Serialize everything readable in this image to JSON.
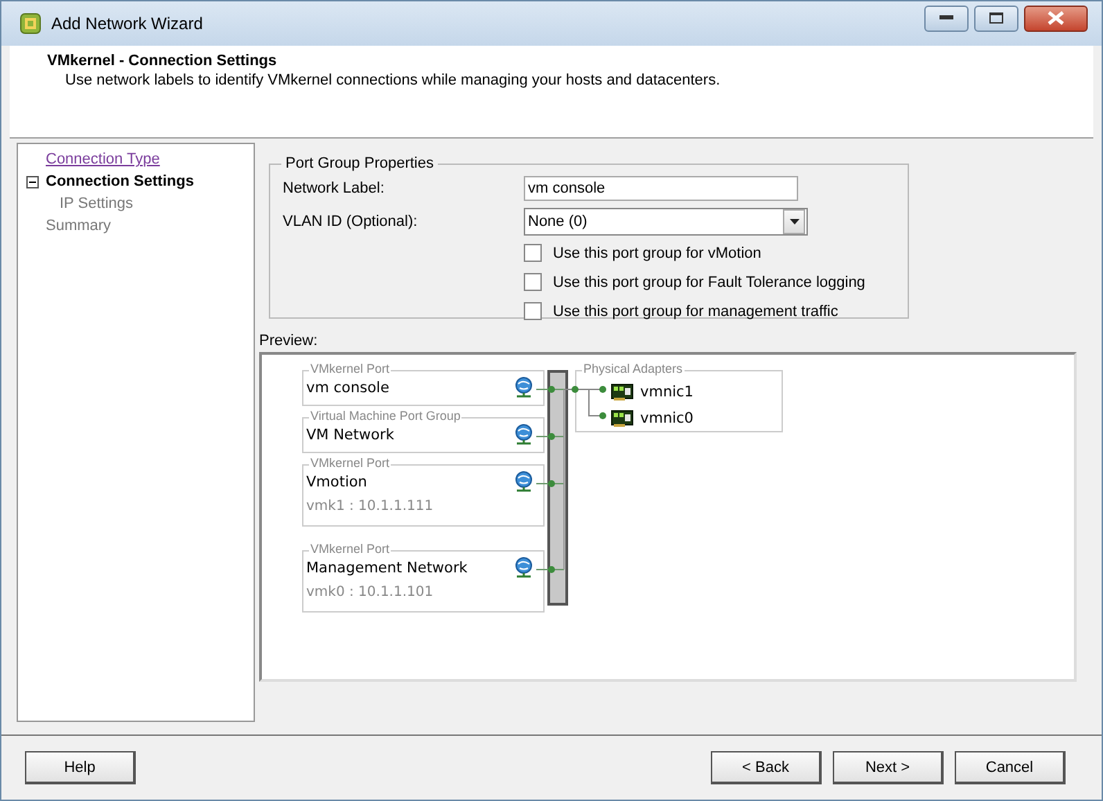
{
  "window": {
    "title": "Add Network Wizard"
  },
  "header": {
    "title": "VMkernel - Connection Settings",
    "description": "Use network labels to identify VMkernel connections while managing your hosts and datacenters."
  },
  "steps": [
    {
      "label": "Connection Type",
      "kind": "link",
      "selected": false
    },
    {
      "label": "Connection Settings",
      "kind": "current",
      "selected": true,
      "expanded": true,
      "children": [
        {
          "label": "IP Settings",
          "kind": "pending",
          "selected": false
        }
      ]
    },
    {
      "label": "Summary",
      "kind": "pending",
      "selected": false
    }
  ],
  "port_group_properties": {
    "title": "Port Group Properties",
    "network_label": {
      "label": "Network Label:",
      "value": "vm console"
    },
    "vlan_id": {
      "label": "VLAN ID (Optional):",
      "value": "None (0)"
    },
    "options": [
      {
        "label": "Use this port group for vMotion",
        "checked": false
      },
      {
        "label": "Use this port group for Fault Tolerance logging",
        "checked": false
      },
      {
        "label": "Use this port group for management traffic",
        "checked": false
      }
    ]
  },
  "preview": {
    "label": "Preview:",
    "port_groups": [
      {
        "group_type": "VMkernel Port",
        "name": "vm console"
      },
      {
        "group_type": "Virtual Machine Port Group",
        "name": "VM Network"
      },
      {
        "group_type": "VMkernel Port",
        "name": "Vmotion",
        "detail": "vmk1 : 10.1.1.111"
      },
      {
        "group_type": "VMkernel Port",
        "name": "Management Network",
        "detail": "vmk0 : 10.1.1.101"
      }
    ],
    "physical_adapters": {
      "title": "Physical Adapters",
      "adapters": [
        "vmnic1",
        "vmnic0"
      ]
    }
  },
  "buttons": {
    "help": "Help",
    "back": "< Back",
    "next": "Next >",
    "cancel": "Cancel"
  }
}
